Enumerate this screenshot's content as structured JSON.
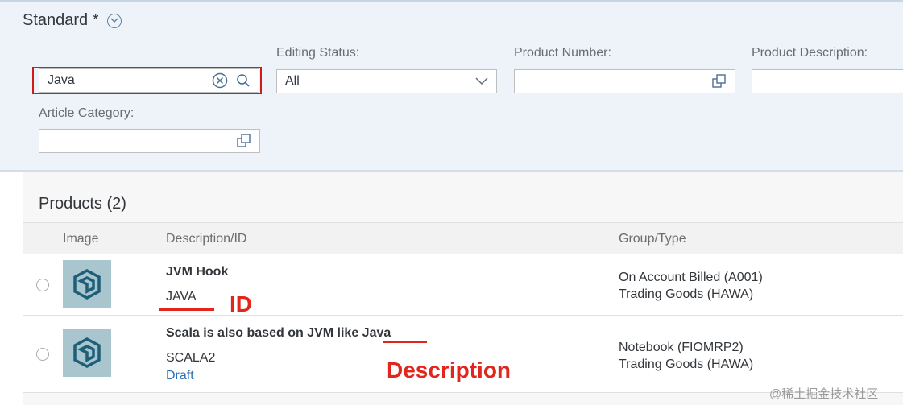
{
  "filterbar": {
    "variant_title": "Standard *",
    "search": {
      "value": "Java"
    },
    "editing_status": {
      "label": "Editing Status:",
      "value": "All"
    },
    "product_number": {
      "label": "Product Number:",
      "value": ""
    },
    "product_description": {
      "label": "Product Description:",
      "value": ""
    },
    "article_category": {
      "label": "Article Category:",
      "value": ""
    }
  },
  "products": {
    "title": "Products (2)",
    "columns": {
      "image": "Image",
      "description": "Description/ID",
      "group": "Group/Type"
    },
    "rows": [
      {
        "description": "JVM Hook",
        "id": "JAVA",
        "status": "",
        "group": "On Account Billed (A001)",
        "type": "Trading Goods (HAWA)"
      },
      {
        "description": "Scala is also based on JVM like Java",
        "id": "SCALA2",
        "status": "Draft",
        "group": "Notebook (FIOMRP2)",
        "type": "Trading Goods (HAWA)"
      }
    ]
  },
  "annotations": {
    "id_label": "ID",
    "description_label": "Description",
    "color": "#e1261c"
  },
  "watermark": "@稀土掘金技术社区",
  "colors": {
    "accent": "#2a72b5",
    "filter_bg": "#edf3f8",
    "highlight": "#d21a1a"
  }
}
